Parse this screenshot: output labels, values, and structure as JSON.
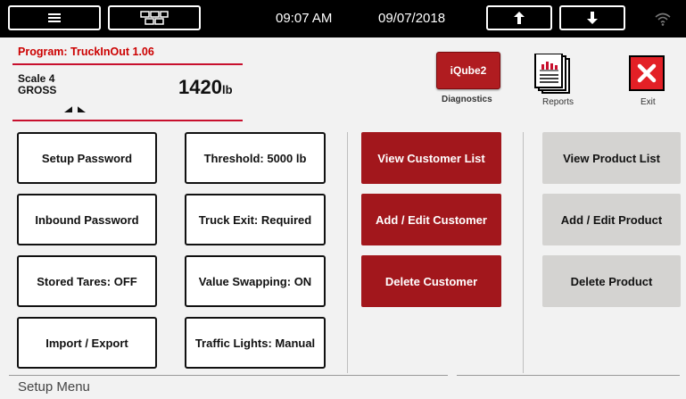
{
  "topbar": {
    "menu_icon": "hamburger-icon",
    "grid_icon": "grid-icon",
    "time": "09:07 AM",
    "date": "09/07/2018",
    "up_icon": "arrow-up-icon",
    "down_icon": "arrow-down-icon",
    "wifi_icon": "wifi-icon"
  },
  "header": {
    "program": "Program: TruckInOut 1.06",
    "scale_name": "Scale 4",
    "scale_mode": "GROSS",
    "weight_value": "1420",
    "weight_unit": "lb",
    "diagnostics_button": "iQube2",
    "diagnostics_label": "Diagnostics",
    "reports_label": "Reports",
    "exit_label": "Exit"
  },
  "settings_buttons": [
    "Setup Password",
    "Inbound Password",
    "Stored Tares: OFF",
    "Import / Export"
  ],
  "config_buttons": [
    "Threshold: 5000 lb",
    "Truck Exit: Required",
    "Value Swapping: ON",
    "Traffic Lights: Manual"
  ],
  "customer_buttons": [
    "View Customer List",
    "Add / Edit Customer",
    "Delete Customer"
  ],
  "product_buttons": [
    "View Product List",
    "Add / Edit Product",
    "Delete Product"
  ],
  "footer": {
    "title": "Setup Menu"
  },
  "colors": {
    "accent_red": "#a2171c",
    "gray_button": "#d4d3d1",
    "topbar": "#000000"
  }
}
